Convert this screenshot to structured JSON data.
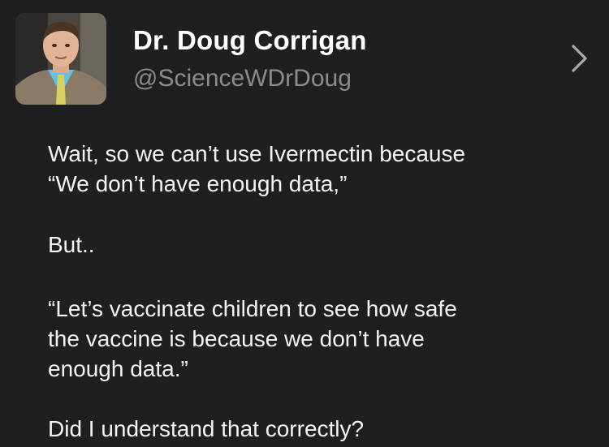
{
  "profile": {
    "display_name": "Dr. Doug Corrigan",
    "handle": "@ScienceWDrDoug",
    "avatar_icon": "user-avatar-photo",
    "chevron_icon": "chevron-right-icon"
  },
  "tweet": {
    "paragraphs": [
      "Wait, so we can’t use Ivermectin because\n“We don’t have enough data,”",
      "But..",
      "“Let’s vaccinate children to see how safe\nthe vaccine is because we don’t have\nenough data.”",
      "Did I understand that correctly?"
    ]
  },
  "colors": {
    "background": "#1f1f21",
    "name": "#ffffff",
    "handle": "#8b8b8e",
    "body_text": "#f4f4f4"
  }
}
